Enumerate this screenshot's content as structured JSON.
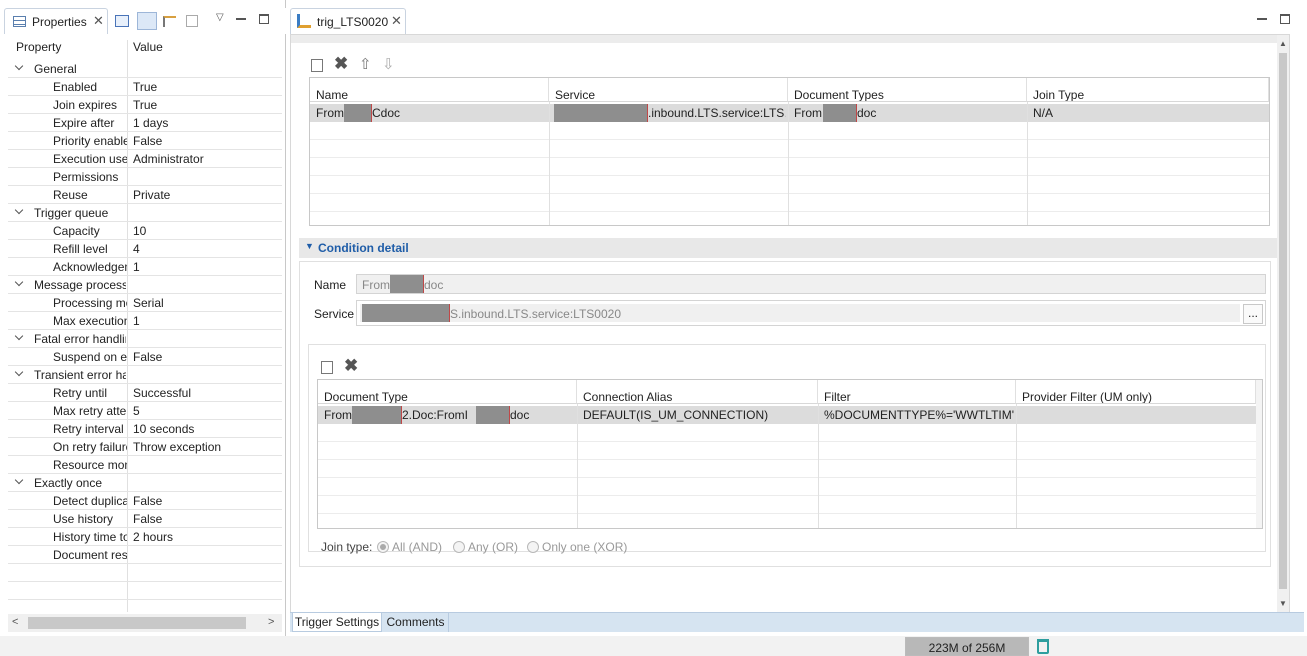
{
  "properties_view": {
    "tab_label": "Properties",
    "col_property": "Property",
    "col_value": "Value",
    "rows": [
      {
        "name": "General",
        "value": "",
        "group": true
      },
      {
        "name": "Enabled",
        "value": "True"
      },
      {
        "name": "Join expires",
        "value": "True"
      },
      {
        "name": "Expire after",
        "value": "1 days"
      },
      {
        "name": "Priority enable",
        "value": "False"
      },
      {
        "name": "Execution user",
        "value": "Administrator"
      },
      {
        "name": "Permissions",
        "value": ""
      },
      {
        "name": "Reuse",
        "value": "Private"
      },
      {
        "name": "Trigger queue",
        "value": "",
        "group": true
      },
      {
        "name": "Capacity",
        "value": "10"
      },
      {
        "name": "Refill level",
        "value": "4"
      },
      {
        "name": "Acknowledgement",
        "value": "1"
      },
      {
        "name": "Message processing",
        "value": "",
        "group": true
      },
      {
        "name": "Processing mode",
        "value": "Serial"
      },
      {
        "name": "Max execution",
        "value": "1"
      },
      {
        "name": "Fatal error handling",
        "value": "",
        "group": true
      },
      {
        "name": "Suspend on error",
        "value": "False"
      },
      {
        "name": "Transient error handling",
        "value": "",
        "group": true
      },
      {
        "name": "Retry until",
        "value": "Successful"
      },
      {
        "name": "Max retry attempts",
        "value": "5"
      },
      {
        "name": "Retry interval",
        "value": "10 seconds"
      },
      {
        "name": "On retry failure",
        "value": "Throw exception"
      },
      {
        "name": "Resource monitoring",
        "value": ""
      },
      {
        "name": "Exactly once",
        "value": "",
        "group": true
      },
      {
        "name": "Detect duplicates",
        "value": "False"
      },
      {
        "name": "Use history",
        "value": "False"
      },
      {
        "name": "History time to live",
        "value": "2 hours"
      },
      {
        "name": "Document resolver",
        "value": ""
      }
    ]
  },
  "editor": {
    "tab_label": "trig_LTS0020",
    "conditions_table": {
      "headers": [
        "Name",
        "Service",
        "Document Types",
        "Join Type"
      ],
      "row": {
        "name_pre": "From",
        "name_post": "Cdoc",
        "service_post": ".inbound.LTS.service:LTS…",
        "doctype_pre": "From",
        "doctype_post": "doc",
        "join": "N/A"
      }
    },
    "condition_detail": {
      "title": "Condition detail",
      "name_label": "Name",
      "name_pre": "From",
      "name_post": "doc",
      "service_label": "Service",
      "service_post": "S.inbound.LTS.service:LTS0020",
      "browse": "...",
      "doc_table": {
        "headers": [
          "Document Type",
          "Connection Alias",
          "Filter",
          "Provider Filter (UM only)"
        ],
        "row": {
          "doc_pre": "From",
          "doc_mid": "2.Doc:FromI",
          "doc_post": "doc",
          "alias": "DEFAULT(IS_UM_CONNECTION)",
          "filter": "%DOCUMENTTYPE%='WWTLTIM'",
          "provider": ""
        }
      },
      "join_label": "Join type:",
      "join_options": [
        "All (AND)",
        "Any (OR)",
        "Only one (XOR)"
      ]
    },
    "bottom_tabs": [
      "Trigger Settings",
      "Comments"
    ]
  },
  "status": {
    "heap": "223M of 256M"
  }
}
